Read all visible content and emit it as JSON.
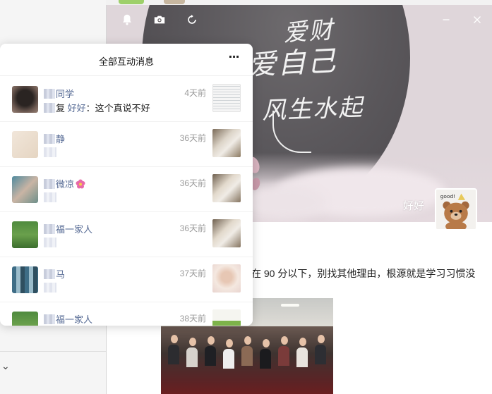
{
  "moments": {
    "cover_calligraphy": [
      "爱财",
      "爱自己",
      "风生水起"
    ],
    "profile_name": "好好",
    "profile_avatar_text": "good!",
    "post_text_line1": "在 90 分以下，别找其他理由，根源就是学习习惯没",
    "post_text_line2": ""
  },
  "toolbar": {
    "icons": [
      "bell-icon",
      "camera-icon",
      "refresh-icon",
      "minimize-icon",
      "close-icon"
    ]
  },
  "popup": {
    "title": "全部互动消息",
    "more_label": "···",
    "notifications": [
      {
        "name": "同学",
        "commenter": "好好",
        "comment": "：这个真说不好",
        "comment_prefix": "复",
        "time": "4天前",
        "thumb": "document"
      },
      {
        "name": "静",
        "comment": "",
        "time": "36天前",
        "thumb": "baby"
      },
      {
        "name": "微凉",
        "comment": "",
        "time": "36天前",
        "thumb": "baby"
      },
      {
        "name": "福一家人",
        "comment": "",
        "time": "36天前",
        "thumb": "baby"
      },
      {
        "name": "马",
        "comment": "",
        "time": "37天前",
        "thumb": "portrait"
      },
      {
        "name": "福一家人",
        "comment": "",
        "time": "38天前",
        "thumb": "green"
      }
    ]
  },
  "colors": {
    "link_blue": "#576b95",
    "time_gray": "#9a9a9a"
  }
}
